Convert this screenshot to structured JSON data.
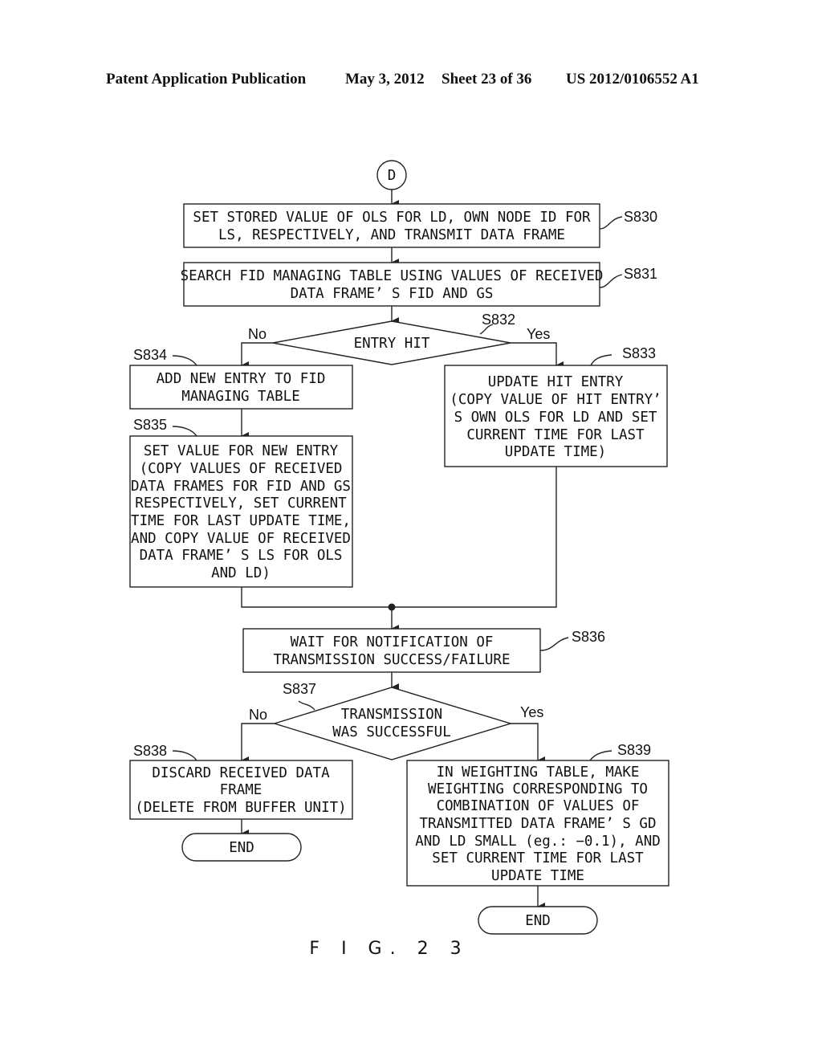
{
  "header": {
    "publication": "Patent Application Publication",
    "date": "May 3, 2012",
    "sheet": "Sheet 23 of 36",
    "number": "US 2012/0106552 A1"
  },
  "connector": "D",
  "steps": {
    "s830": {
      "id": "S830",
      "lines": [
        "SET STORED VALUE OF OLS FOR LD, OWN NODE ID FOR",
        "LS, RESPECTIVELY, AND TRANSMIT DATA FRAME"
      ]
    },
    "s831": {
      "id": "S831",
      "lines": [
        "SEARCH FID MANAGING TABLE USING VALUES OF RECEIVED",
        "DATA FRAME’ S FID AND GS"
      ]
    },
    "s832": {
      "id": "S832",
      "lines": [
        "ENTRY HIT"
      ],
      "no": "No",
      "yes": "Yes"
    },
    "s833": {
      "id": "S833",
      "lines": [
        "UPDATE HIT ENTRY",
        "(COPY VALUE OF HIT ENTRY’",
        "S OWN OLS FOR LD AND SET",
        "CURRENT TIME FOR LAST",
        "UPDATE TIME)"
      ]
    },
    "s834": {
      "id": "S834",
      "lines": [
        "ADD NEW ENTRY TO FID",
        "MANAGING TABLE"
      ]
    },
    "s835": {
      "id": "S835",
      "lines": [
        "SET VALUE FOR NEW ENTRY",
        "(COPY VALUES OF RECEIVED",
        "DATA FRAMES FOR FID AND GS",
        "RESPECTIVELY, SET CURRENT",
        "TIME FOR LAST UPDATE TIME,",
        "AND COPY VALUE OF RECEIVED",
        "DATA FRAME’ S LS FOR OLS",
        "AND LD)"
      ]
    },
    "s836": {
      "id": "S836",
      "lines": [
        "WAIT FOR NOTIFICATION OF",
        "TRANSMISSION SUCCESS/FAILURE"
      ]
    },
    "s837": {
      "id": "S837",
      "lines": [
        "TRANSMISSION",
        "WAS SUCCESSFUL"
      ],
      "no": "No",
      "yes": "Yes"
    },
    "s838": {
      "id": "S838",
      "lines": [
        "DISCARD RECEIVED DATA",
        "FRAME",
        "(DELETE FROM BUFFER UNIT)"
      ]
    },
    "s839": {
      "id": "S839",
      "lines": [
        "IN WEIGHTING TABLE, MAKE",
        "WEIGHTING CORRESPONDING TO",
        "COMBINATION OF VALUES OF",
        "TRANSMITTED DATA FRAME’ S GD",
        "AND LD SMALL (eg.: −0.1), AND",
        "SET CURRENT TIME FOR LAST",
        "UPDATE TIME"
      ]
    }
  },
  "end_left": "END",
  "end_right": "END",
  "figure_label": "F I G. 2 3"
}
